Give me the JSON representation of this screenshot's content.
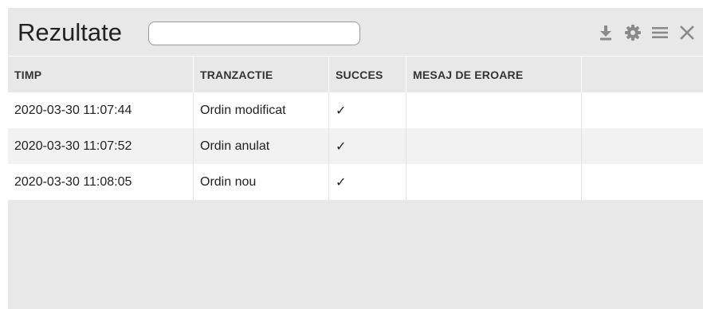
{
  "panel": {
    "title": "Rezultate",
    "search": {
      "value": "",
      "placeholder": ""
    },
    "tools": [
      {
        "icon": "download-icon"
      },
      {
        "icon": "gear-icon"
      },
      {
        "icon": "menu-icon"
      },
      {
        "icon": "close-icon"
      }
    ]
  },
  "table": {
    "columns": [
      "TIMP",
      "TRANZACTIE",
      "SUCCES",
      "MESAJ DE EROARE",
      ""
    ],
    "rows": [
      {
        "timp": "2020-03-30 11:07:44",
        "tranzactie": "Ordin modificat",
        "succes": "✓",
        "mesaj": ""
      },
      {
        "timp": "2020-03-30 11:07:52",
        "tranzactie": "Ordin anulat",
        "succes": "✓",
        "mesaj": ""
      },
      {
        "timp": "2020-03-30 11:08:05",
        "tranzactie": "Ordin nou",
        "succes": "✓",
        "mesaj": ""
      }
    ]
  },
  "colors": {
    "panel_bg": "#e8e8e8",
    "row_alt": "#f2f2f2",
    "icon": "#8a8a8a"
  }
}
